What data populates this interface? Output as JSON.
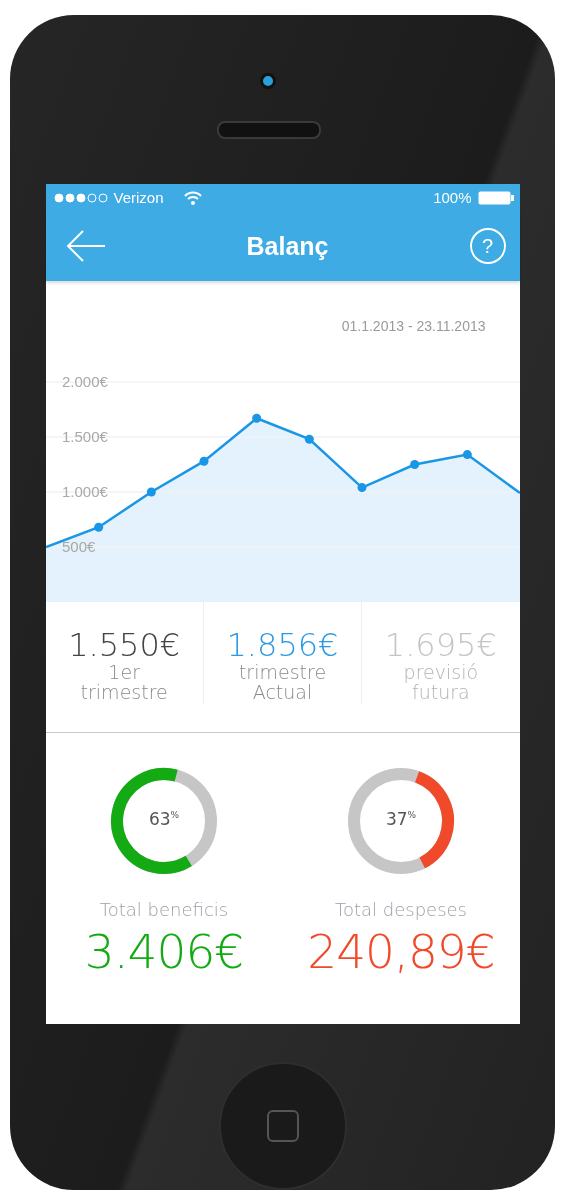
{
  "status_bar": {
    "carrier": "Verizon",
    "battery": "100%"
  },
  "nav": {
    "title": "Balanç",
    "help_button": "?"
  },
  "date_range": "01.1.2013 - 23.11.2013",
  "chart": {
    "chart_data": {
      "type": "area",
      "grid": true,
      "ylim": [
        0,
        2100
      ],
      "yticks": [
        {
          "value": 500,
          "label": "500€"
        },
        {
          "value": 1000,
          "label": "1.000€"
        },
        {
          "value": 1500,
          "label": "1.500€"
        },
        {
          "value": 2000,
          "label": "2.000€"
        }
      ],
      "series": [
        {
          "color": "#1a96e6",
          "values": [
            500,
            680,
            1000,
            1280,
            1670,
            1480,
            1040,
            1250,
            1340,
            990
          ]
        }
      ]
    }
  },
  "quarters": [
    {
      "kind": "past",
      "value": "1.550€",
      "label": "1er trimestre"
    },
    {
      "kind": "current",
      "value": "1.856€",
      "label": "trimestre Actual"
    },
    {
      "kind": "forecast",
      "value": "1.695€",
      "label": "previsió futura"
    }
  ],
  "totals": [
    {
      "kind": "income",
      "percent": "63$^{%}$",
      "level": 0.63,
      "color": "#14aa14",
      "label": "Total beneficis",
      "amount": "3.406€"
    },
    {
      "kind": "expense",
      "percent": "37$^{%}$",
      "level": 0.37,
      "color": "#f04a2a",
      "label": "Total despeses",
      "amount": "240,89€"
    }
  ]
}
